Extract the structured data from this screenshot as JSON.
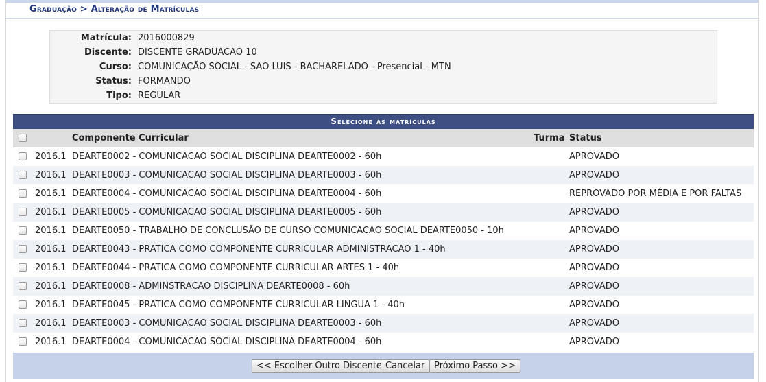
{
  "breadcrumb": {
    "section": "Graduação",
    "separator": ">",
    "page": "Alteração de Matrículas"
  },
  "student": {
    "matricula_label": "Matrícula:",
    "matricula": "2016000829",
    "discente_label": "Discente:",
    "discente": "DISCENTE GRADUACAO 10",
    "curso_label": "Curso:",
    "curso": "COMUNICAÇÃO SOCIAL - SAO LUIS - BACHARELADO - Presencial - MTN",
    "status_label": "Status:",
    "status": "FORMANDO",
    "tipo_label": "Tipo:",
    "tipo": "REGULAR"
  },
  "table": {
    "title": "Selecione as matrículas",
    "headers": {
      "componente": "Componente Curricular",
      "turma": "Turma",
      "status": "Status"
    },
    "rows": [
      {
        "period": "2016.1",
        "component": "DEARTE0002 - COMUNICACAO SOCIAL DISCIPLINA DEARTE0002 - 60h",
        "turma": "",
        "status": "APROVADO"
      },
      {
        "period": "2016.1",
        "component": "DEARTE0003 - COMUNICACAO SOCIAL DISCIPLINA DEARTE0003 - 60h",
        "turma": "",
        "status": "APROVADO"
      },
      {
        "period": "2016.1",
        "component": "DEARTE0004 - COMUNICACAO SOCIAL DISCIPLINA DEARTE0004 - 60h",
        "turma": "",
        "status": "REPROVADO POR MÉDIA E POR FALTAS"
      },
      {
        "period": "2016.1",
        "component": "DEARTE0005 - COMUNICACAO SOCIAL DISCIPLINA DEARTE0005 - 60h",
        "turma": "",
        "status": "APROVADO"
      },
      {
        "period": "2016.1",
        "component": "DEARTE0050 - TRABALHO DE CONCLUSÃO DE CURSO COMUNICACAO SOCIAL DEARTE0050 - 10h",
        "turma": "",
        "status": "APROVADO"
      },
      {
        "period": "2016.1",
        "component": "DEARTE0043 - PRATICA COMO COMPONENTE CURRICULAR ADMINISTRACAO 1 - 40h",
        "turma": "",
        "status": "APROVADO"
      },
      {
        "period": "2016.1",
        "component": "DEARTE0044 - PRATICA COMO COMPONENTE CURRICULAR ARTES 1 - 40h",
        "turma": "",
        "status": "APROVADO"
      },
      {
        "period": "2016.1",
        "component": "DEARTE0008 - ADMINSTRACAO DISCIPLINA DEARTE0008 - 60h",
        "turma": "",
        "status": "APROVADO"
      },
      {
        "period": "2016.1",
        "component": "DEARTE0045 - PRATICA COMO COMPONENTE CURRICULAR LINGUA 1 - 40h",
        "turma": "",
        "status": "APROVADO"
      },
      {
        "period": "2016.1",
        "component": "DEARTE0003 - COMUNICACAO SOCIAL DISCIPLINA DEARTE0003 - 60h",
        "turma": "",
        "status": "APROVADO"
      },
      {
        "period": "2016.1",
        "component": "DEARTE0004 - COMUNICACAO SOCIAL DISCIPLINA DEARTE0004 - 60h",
        "turma": "",
        "status": "APROVADO"
      }
    ]
  },
  "buttons": {
    "back": "<< Escolher Outro Discente",
    "cancel": "Cancelar",
    "next": "Próximo Passo >>"
  },
  "colors": {
    "header_bg": "#3e4f83",
    "breadcrumb_text": "#22377a",
    "footer_bg": "#c5d2ea",
    "row_alt": "#eef1f6"
  }
}
